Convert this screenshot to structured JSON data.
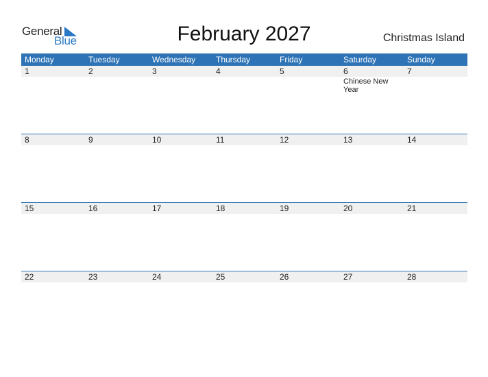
{
  "logo": {
    "line1": "General",
    "line2": "Blue"
  },
  "header": {
    "title": "February 2027",
    "region": "Christmas Island"
  },
  "weekdays": [
    "Monday",
    "Tuesday",
    "Wednesday",
    "Thursday",
    "Friday",
    "Saturday",
    "Sunday"
  ],
  "weeks": [
    {
      "days": [
        {
          "num": "1",
          "event": ""
        },
        {
          "num": "2",
          "event": ""
        },
        {
          "num": "3",
          "event": ""
        },
        {
          "num": "4",
          "event": ""
        },
        {
          "num": "5",
          "event": ""
        },
        {
          "num": "6",
          "event": "Chinese New Year"
        },
        {
          "num": "7",
          "event": ""
        }
      ]
    },
    {
      "days": [
        {
          "num": "8",
          "event": ""
        },
        {
          "num": "9",
          "event": ""
        },
        {
          "num": "10",
          "event": ""
        },
        {
          "num": "11",
          "event": ""
        },
        {
          "num": "12",
          "event": ""
        },
        {
          "num": "13",
          "event": ""
        },
        {
          "num": "14",
          "event": ""
        }
      ]
    },
    {
      "days": [
        {
          "num": "15",
          "event": ""
        },
        {
          "num": "16",
          "event": ""
        },
        {
          "num": "17",
          "event": ""
        },
        {
          "num": "18",
          "event": ""
        },
        {
          "num": "19",
          "event": ""
        },
        {
          "num": "20",
          "event": ""
        },
        {
          "num": "21",
          "event": ""
        }
      ]
    },
    {
      "days": [
        {
          "num": "22",
          "event": ""
        },
        {
          "num": "23",
          "event": ""
        },
        {
          "num": "24",
          "event": ""
        },
        {
          "num": "25",
          "event": ""
        },
        {
          "num": "26",
          "event": ""
        },
        {
          "num": "27",
          "event": ""
        },
        {
          "num": "28",
          "event": ""
        }
      ]
    }
  ],
  "colors": {
    "accent": "#2e73b5",
    "day_band": "#f0f0f0",
    "logo_blue": "#2a78c5"
  }
}
